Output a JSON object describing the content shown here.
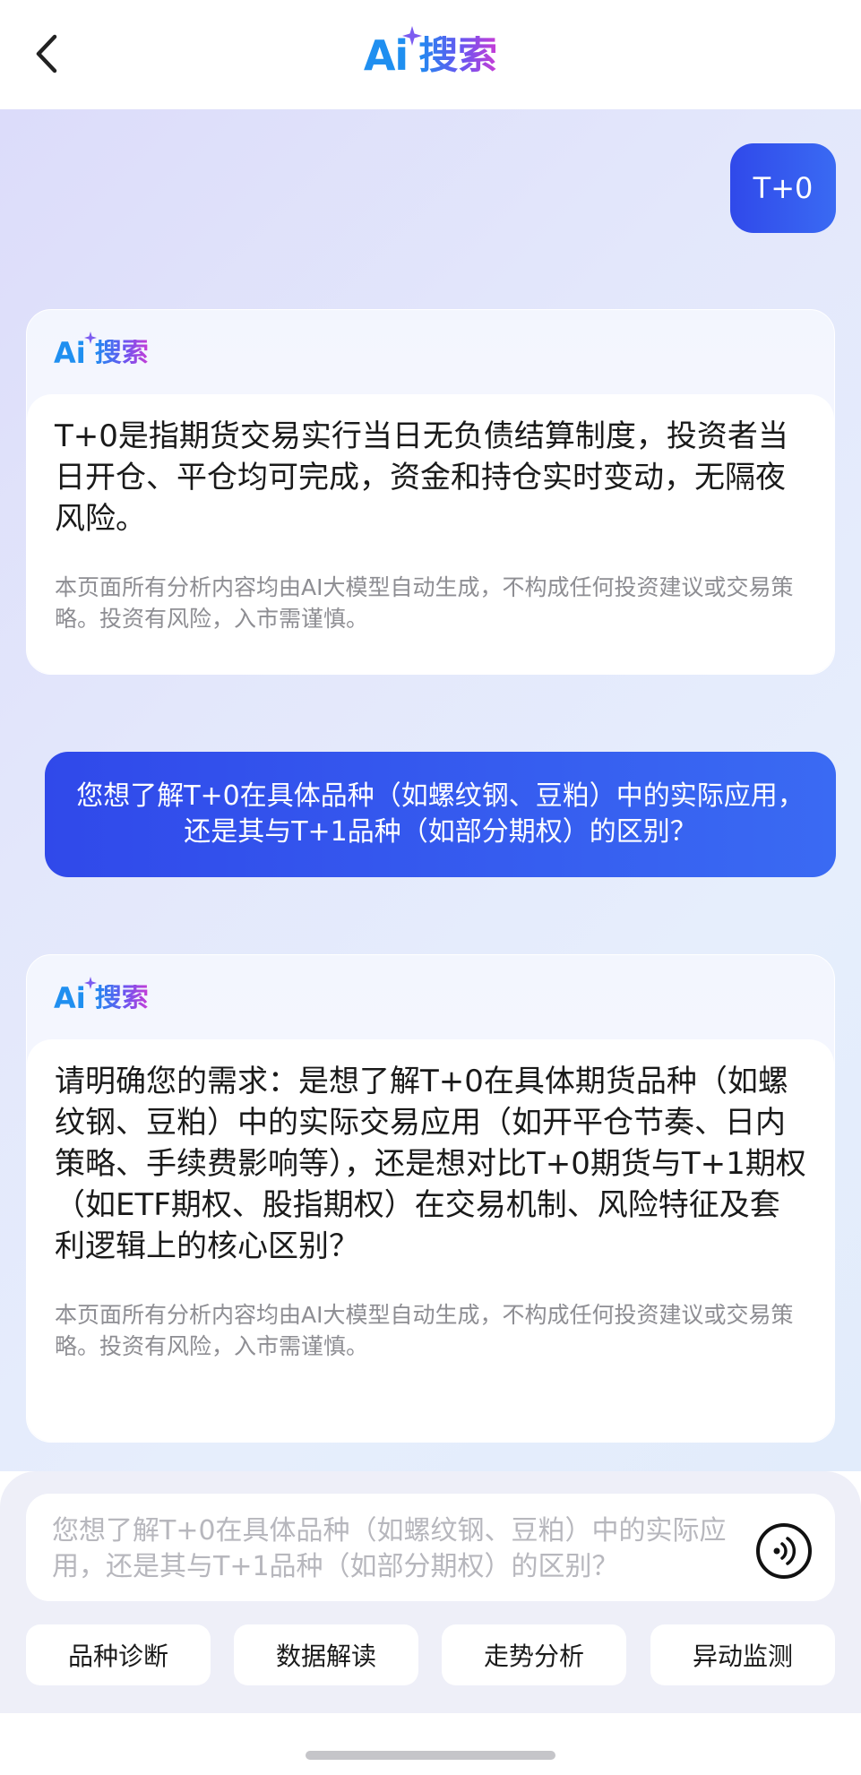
{
  "header": {
    "logo_mark": "Ai",
    "logo_text": "搜索",
    "back_icon": "chevron-left-icon"
  },
  "conversation": {
    "user_message_1": "T+0",
    "ai_card_1": {
      "logo_mark": "Ai",
      "title": "搜索",
      "answer": "T+0是指期货交易实行当日无负债结算制度，投资者当日开仓、平仓均可完成，资金和持仓实时变动，无隔夜风险。",
      "disclaimer": "本页面所有分析内容均由AI大模型自动生成，不构成任何投资建议或交易策略。投资有风险，入市需谨慎。"
    },
    "user_message_2": "您想了解T+0在具体品种（如螺纹钢、豆粕）中的实际应用，还是其与T+1品种（如部分期权）的区别？",
    "ai_card_2": {
      "logo_mark": "Ai",
      "title": "搜索",
      "answer": "请明确您的需求：是想了解T+0在具体期货品种（如螺纹钢、豆粕）中的实际交易应用（如开平仓节奏、日内策略、手续费影响等），还是想对比T+0期货与T+1期权（如ETF期权、股指期权）在交易机制、风险特征及套利逻辑上的核心区别？",
      "disclaimer": "本页面所有分析内容均由AI大模型自动生成，不构成任何投资建议或交易策略。投资有风险，入市需谨慎。"
    }
  },
  "input": {
    "placeholder": "您想了解T+0在具体品种（如螺纹钢、豆粕）中的实际应用，还是其与T+1品种（如部分期权）的区别？",
    "voice_icon": "voice-input-icon"
  },
  "quick_actions": [
    "品种诊断",
    "数据解读",
    "走势分析",
    "异动监测"
  ],
  "colors": {
    "accent_blue": "#3049ea",
    "logo_gradient_start": "#1e8cf0",
    "logo_gradient_end": "#c83cd6",
    "chat_background": "#e3e7fb"
  }
}
